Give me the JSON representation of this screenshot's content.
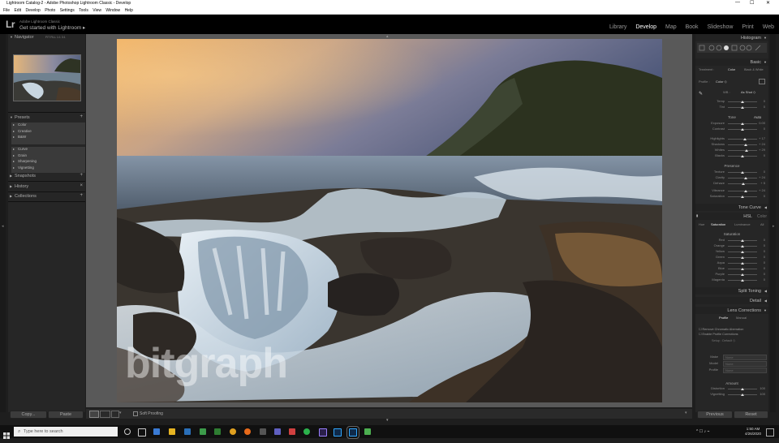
{
  "window": {
    "title": "Lightroom Catalog-2 - Adobe Photoshop Lightroom Classic - Develop",
    "controls": [
      "—",
      "☐",
      "✕"
    ]
  },
  "menu": [
    "File",
    "Edit",
    "Develop",
    "Photo",
    "Settings",
    "Tools",
    "View",
    "Window",
    "Help"
  ],
  "identity": {
    "logo": "Lr",
    "line1": "Adobe Lightroom Classic",
    "line2": "Get started with Lightroom ▸"
  },
  "modules": [
    {
      "label": "Library",
      "active": false
    },
    {
      "label": "Develop",
      "active": true
    },
    {
      "label": "Map",
      "active": false
    },
    {
      "label": "Book",
      "active": false
    },
    {
      "label": "Slideshow",
      "active": false
    },
    {
      "label": "Print",
      "active": false
    },
    {
      "label": "Web",
      "active": false
    }
  ],
  "left_panel": {
    "navigator": {
      "label": "Navigator",
      "zoom_opts": "FIT  FILL  1:1  3:1"
    },
    "presets": {
      "label": "Presets",
      "group1": [
        "Color",
        "Creative",
        "B&W"
      ],
      "group2": [
        "Curve",
        "Grain",
        "Sharpening",
        "Vignetting"
      ]
    },
    "snapshots": "Snapshots",
    "history": "History",
    "collections": "Collections",
    "copy_label": "Copy...",
    "paste_label": "Paste"
  },
  "toolbar": {
    "soft_proofing": "Soft Proofing"
  },
  "watermark": "bitgraph",
  "right_panel": {
    "histogram": "Histogram",
    "basic": {
      "label": "Basic",
      "treatment": [
        "Treatment :",
        "Color",
        "Black & White"
      ],
      "profile_label": "Profile :",
      "profile_value": "Color ◇",
      "wb_label": "WB :",
      "wb_value": "As Shot ◇",
      "temp_tint": [
        {
          "label": "Temp",
          "value": "0",
          "pos": 0.5
        },
        {
          "label": "Tint",
          "value": "0",
          "pos": 0.5
        }
      ],
      "tone_label": "Tone",
      "auto_label": "Auto",
      "tone_rows": [
        {
          "label": "Exposure",
          "value": "0.00",
          "pos": 0.5
        },
        {
          "label": "Contrast",
          "value": "0",
          "pos": 0.5
        }
      ],
      "tone_rows2": [
        {
          "label": "Highlights",
          "value": "+ 17",
          "pos": 0.58
        },
        {
          "label": "Shadows",
          "value": "+ 24",
          "pos": 0.62
        },
        {
          "label": "Whites",
          "value": "+ 29",
          "pos": 0.64
        },
        {
          "label": "Blacks",
          "value": "0",
          "pos": 0.5
        }
      ],
      "presence_label": "Presence",
      "presence_rows": [
        {
          "label": "Texture",
          "value": "0",
          "pos": 0.5
        },
        {
          "label": "Clarity",
          "value": "+ 24",
          "pos": 0.62
        },
        {
          "label": "Dehaze",
          "value": "+ 5",
          "pos": 0.53
        }
      ],
      "presence_rows2": [
        {
          "label": "Vibrance",
          "value": "+ 24",
          "pos": 0.62
        },
        {
          "label": "Saturation",
          "value": "0",
          "pos": 0.5
        }
      ]
    },
    "tone_curve": "Tone Curve",
    "hsl": {
      "label": "HSL",
      "label2": "Color",
      "tabs": [
        "Hue",
        "Saturation",
        "Luminance",
        "All"
      ],
      "section": "Saturation",
      "rows": [
        {
          "label": "Red",
          "value": "0",
          "pos": 0.5
        },
        {
          "label": "Orange",
          "value": "0",
          "pos": 0.5
        },
        {
          "label": "Yellow",
          "value": "0",
          "pos": 0.5
        },
        {
          "label": "Green",
          "value": "0",
          "pos": 0.5
        },
        {
          "label": "Aqua",
          "value": "0",
          "pos": 0.5
        },
        {
          "label": "Blue",
          "value": "0",
          "pos": 0.5
        },
        {
          "label": "Purple",
          "value": "0",
          "pos": 0.5
        },
        {
          "label": "Magenta",
          "value": "0",
          "pos": 0.5
        }
      ]
    },
    "split_toning": "Split Toning",
    "detail": "Detail",
    "lens": {
      "label": "Lens Corrections",
      "tabs": [
        "Profile",
        "Manual"
      ],
      "check1": "Remove Chromatic Aberration",
      "check2": "Enable Profile Corrections",
      "setup": "Setup : Default ◇",
      "fields": [
        {
          "label": "Make",
          "value": "None"
        },
        {
          "label": "Model",
          "value": "None"
        },
        {
          "label": "Profile",
          "value": "None"
        }
      ],
      "amount": "Amount",
      "amount_rows": [
        {
          "label": "Distortion",
          "value": "100",
          "pos": 0.5
        },
        {
          "label": "Vignetting",
          "value": "100",
          "pos": 0.5
        }
      ]
    },
    "previous_label": "Previous",
    "reset_label": "Reset"
  },
  "taskbar": {
    "search_placeholder": "Type here to search",
    "time": "1:50 AM",
    "date": "4/26/2020"
  }
}
